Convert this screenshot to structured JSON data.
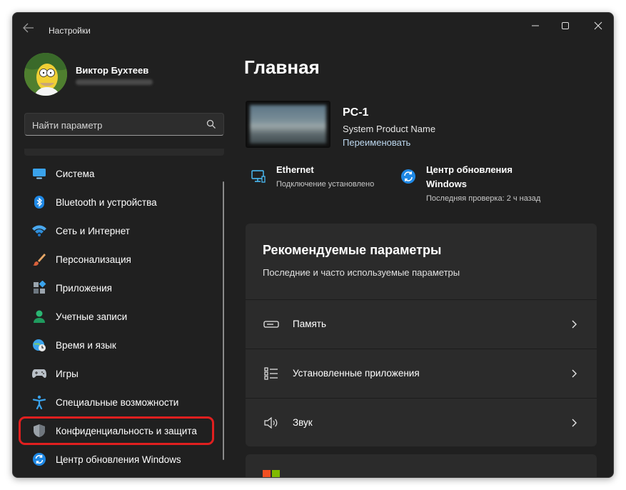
{
  "window": {
    "title": "Настройки"
  },
  "profile": {
    "name": "Виктор Бухтеев"
  },
  "search": {
    "placeholder": "Найти параметр"
  },
  "sidebar": {
    "items": [
      {
        "label": "Система",
        "icon": "monitor-icon"
      },
      {
        "label": "Bluetooth и устройства",
        "icon": "bluetooth-icon"
      },
      {
        "label": "Сеть и Интернет",
        "icon": "wifi-icon"
      },
      {
        "label": "Персонализация",
        "icon": "brush-icon"
      },
      {
        "label": "Приложения",
        "icon": "apps-icon"
      },
      {
        "label": "Учетные записи",
        "icon": "person-icon"
      },
      {
        "label": "Время и язык",
        "icon": "globe-clock-icon"
      },
      {
        "label": "Игры",
        "icon": "gamepad-icon"
      },
      {
        "label": "Специальные возможности",
        "icon": "accessibility-icon"
      },
      {
        "label": "Конфиденциальность и защита",
        "icon": "shield-icon"
      },
      {
        "label": "Центр обновления Windows",
        "icon": "update-icon"
      }
    ]
  },
  "main": {
    "title": "Главная",
    "device": {
      "name": "PC-1",
      "model": "System Product Name",
      "rename": "Переименовать"
    },
    "status": {
      "network": {
        "title": "Ethernet",
        "subtitle": "Подключение установлено"
      },
      "update": {
        "title_line1": "Центр обновления",
        "title_line2": "Windows",
        "subtitle": "Последняя проверка: 2 ч назад"
      }
    },
    "recommended": {
      "title": "Рекомендуемые параметры",
      "subtitle": "Последние и часто используемые параметры",
      "rows": [
        {
          "label": "Память",
          "icon": "storage-icon"
        },
        {
          "label": "Установленные приложения",
          "icon": "app-list-icon"
        },
        {
          "label": "Звук",
          "icon": "speaker-icon"
        }
      ]
    }
  },
  "colors": {
    "window_bg": "#202020",
    "card_bg": "#2b2b2b",
    "accent": "#4cc2ff",
    "highlight": "#e01f1f"
  }
}
